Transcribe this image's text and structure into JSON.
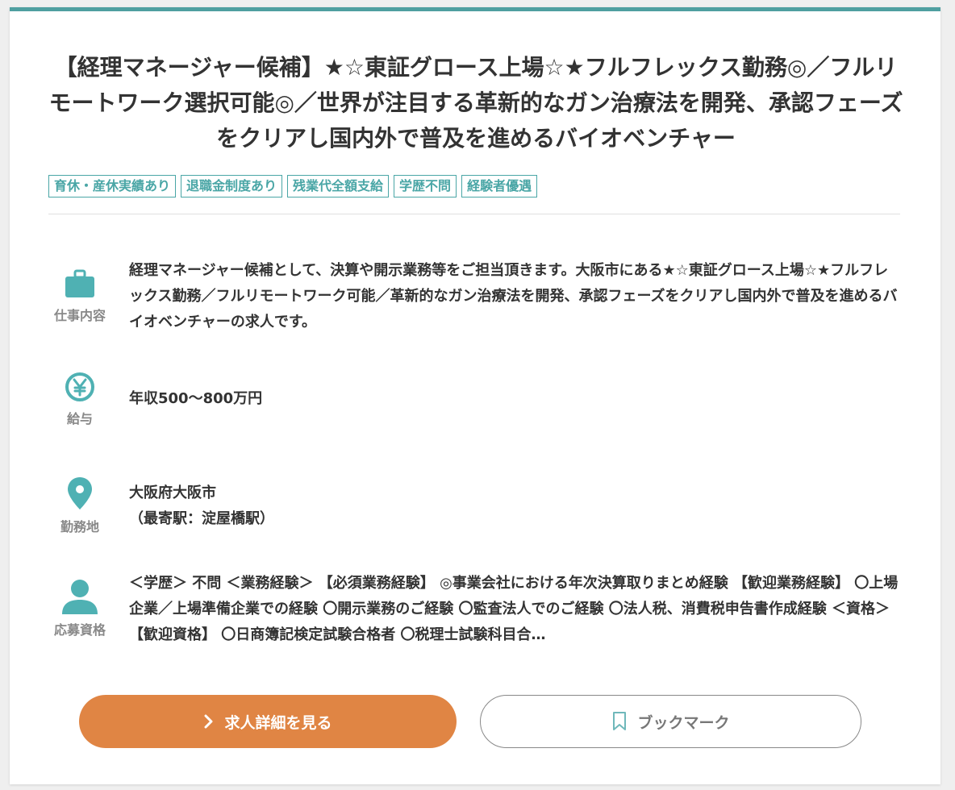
{
  "job": {
    "title": "【経理マネージャー候補】★☆東証グロース上場☆★フルフレックス勤務◎／フルリモートワーク選択可能◎／世界が注目する革新的なガン治療法を開発、承認フェーズをクリアし国内外で普及を進めるバイオベンチャー",
    "tags": [
      "育休・産休実績あり",
      "退職金制度あり",
      "残業代全額支給",
      "学歴不問",
      "経験者優遇"
    ]
  },
  "details": {
    "work": {
      "icon": "briefcase-icon",
      "label": "仕事内容",
      "text": "経理マネージャー候補として、決算や開示業務等をご担当頂きます。大阪市にある★☆東証グロース上場☆★フルフレックス勤務／フルリモートワーク可能／革新的なガン治療法を開発、承認フェーズをクリアし国内外で普及を進めるバイオベンチャーの求人です。"
    },
    "salary": {
      "icon": "yen-icon",
      "label": "給与",
      "text": "年収500〜800万円"
    },
    "location": {
      "icon": "map-pin-icon",
      "label": "勤務地",
      "line1": "大阪府大阪市",
      "line2": "（最寄駅：淀屋橋駅）"
    },
    "qualification": {
      "icon": "person-icon",
      "label": "応募資格",
      "text": "＜学歴＞ 不問 ＜業務経験＞ 【必須業務経験】 ◎事業会社における年次決算取りまとめ経験 【歓迎業務経験】 〇上場企業／上場準備企業での経験 〇開示業務のご経験 〇監査法人でのご経験 〇法人税、消費税申告書作成経験 ＜資格＞ 【歓迎資格】 〇日商簿記検定試験合格者 〇税理士試験科目合…"
    }
  },
  "actions": {
    "detail_label": "求人詳細を見る",
    "bookmark_label": "ブックマーク"
  },
  "colors": {
    "accent": "#4f9fa0",
    "tag": "#4aa6a6",
    "primary_button": "#e08544",
    "icon": "#4fb1b3"
  }
}
